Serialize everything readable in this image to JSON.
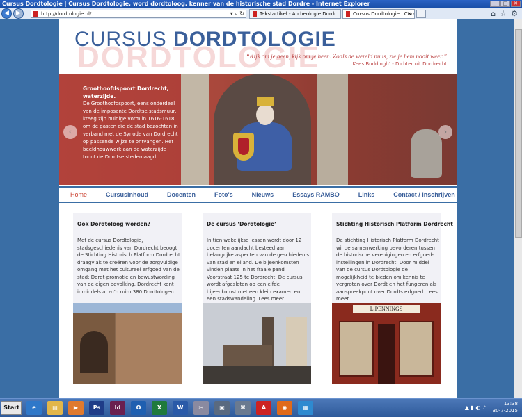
{
  "window": {
    "title": "Cursus Dordtologie | Cursus Dordtologie, word dordtoloog, kenner van de historische stad Dordre - Internet Explorer"
  },
  "browser": {
    "address": "http://dordtologie.nl/",
    "tabs": [
      {
        "label": "Tekstartikel - Archeologie Dordr..."
      },
      {
        "label": "Cursus Dordtologie | Cursus ..."
      }
    ]
  },
  "site": {
    "logo_light": "CURSUS",
    "logo_bold": "DORDTOLOGIE",
    "watermark": "DORDTOLOGIE",
    "quote": "“Kijk om je heen, kijk om je heen. Zoals de wereld nu is, zie je hem nooit weer.”",
    "quote_author": "Kees Buddingh’ - Dichter uit Dordrecht"
  },
  "hero": {
    "caption_title": "Groothoofdspoort Dordrecht, waterzijde.",
    "caption_text": "De Groothoofdspoort, eens onderdeel van de imposante Dordtse stadsmuur, kreeg zijn huidige vorm in 1616-1618 om de gasten die de stad bezochten in verband met de Synode van Dordrecht op passende wijze te ontvangen. Het beeldhouwwerk aan de waterzijde toont de Dordtse stedemaagd."
  },
  "menu": [
    {
      "label": "Home"
    },
    {
      "label": "Cursusinhoud"
    },
    {
      "label": "Docenten"
    },
    {
      "label": "Foto's"
    },
    {
      "label": "Nieuws"
    },
    {
      "label": "Essays RAMBO"
    },
    {
      "label": "Links"
    },
    {
      "label": "Contact / inschrijven"
    }
  ],
  "cards": [
    {
      "title": "Ook Dordtoloog worden?",
      "text": "Met de cursus Dordtologie, stadsgeschiedenis van Dordrecht beoogt de Stichting Historisch Platform Dordrecht draagvlak te creëren voor de zorgvuldige omgang met het cultureel erfgoed van de stad: Dordt-promotie en bewustwording van de eigen bevolking. Dordrecht kent inmiddels al zo’n ruim 380 Dordtologen."
    },
    {
      "title": "De cursus ‘Dordtologie’",
      "text": "In tien wekelijkse lessen wordt door 12 docenten aandacht besteed aan belangrijke aspecten van de geschiedenis van stad en eiland. De bijeenkomsten vinden plaats in het fraaie pand Voorstraat 125 te Dordrecht. De cursus wordt afgesloten op een elfde bijeenkomst met een klein examen en een stadswandeling. Lees meer…"
    },
    {
      "title": "Stichting Historisch Platform Dordrecht",
      "text": "De stichting Historisch Platform Dordrecht wil de samenwerking bevorderen tussen de historische verenigingen en erfgoed-instellingen in Dordrecht. Door middel van de cursus Dordtologie de mogelijkheid te bieden om kennis te vergroten over Dordt en het fungeren als aanspreekpunt over Dordts erfgoed. Lees meer…"
    }
  ],
  "shop_sign": "L.PENNINGS",
  "taskbar": {
    "start_label": "Start",
    "time": "13:38",
    "date": "30-7-2015"
  }
}
